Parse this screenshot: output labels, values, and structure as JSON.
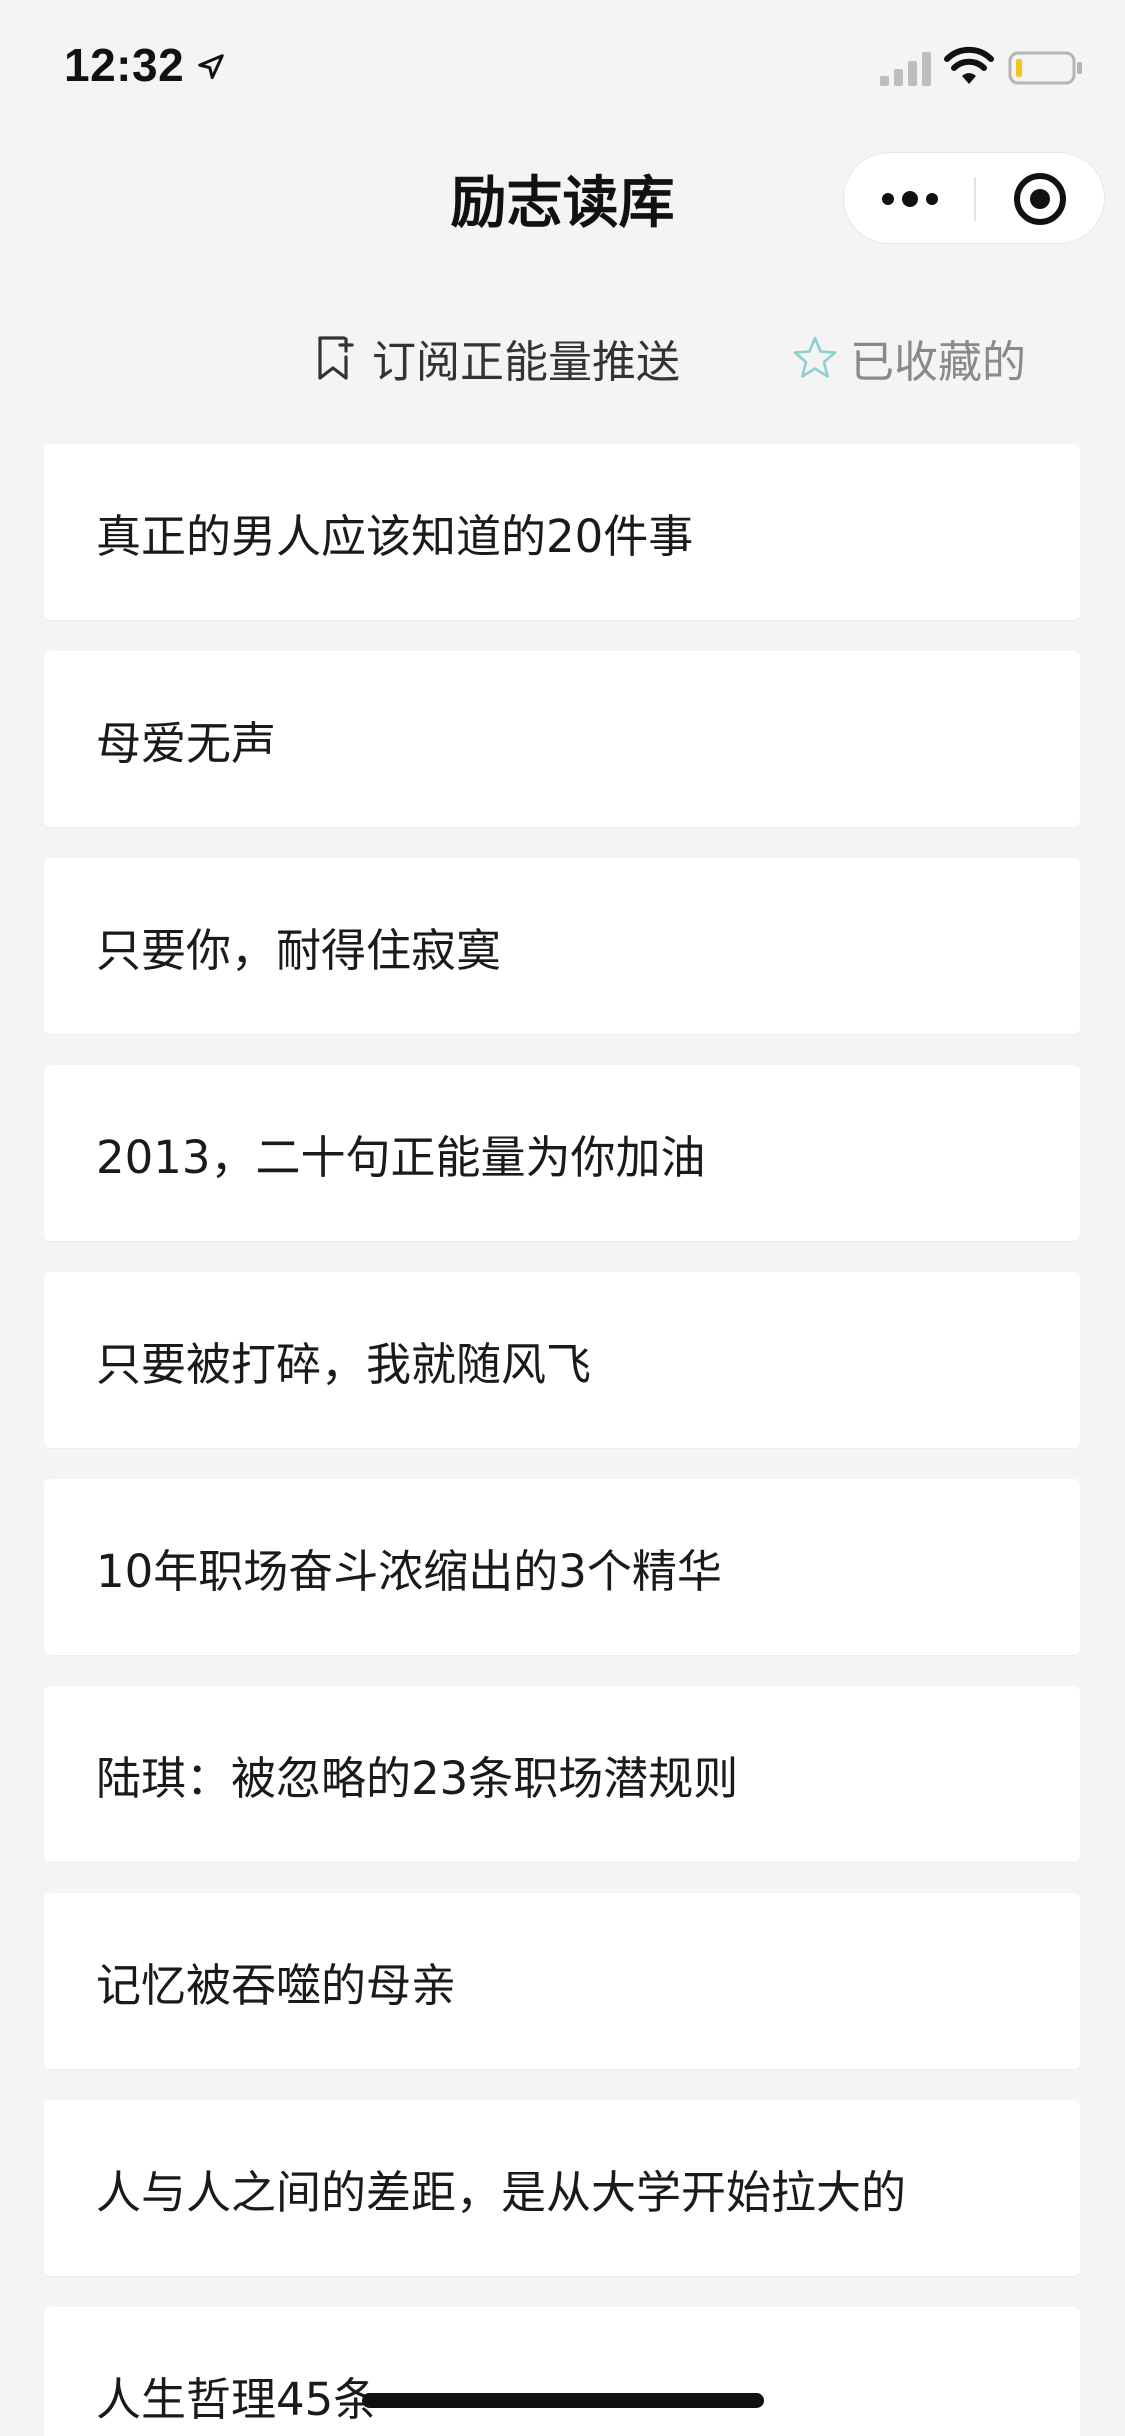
{
  "status_bar": {
    "time": "12:32",
    "icons": [
      "location-arrow-icon",
      "signal-icon",
      "wifi-icon",
      "battery-icon"
    ]
  },
  "nav": {
    "title": "励志读库",
    "capsule_icons": [
      "more-icon",
      "target-icon"
    ]
  },
  "actions": {
    "subscribe_label": "订阅正能量推送",
    "subscribe_icon": "bookmark-plus-icon",
    "favorites_label": "已收藏的",
    "favorites_icon": "star-icon",
    "favorites_icon_color": "#8ecfcf"
  },
  "articles": [
    {
      "title": "真正的男人应该知道的20件事"
    },
    {
      "title": "母爱无声"
    },
    {
      "title": "只要你，耐得住寂寞"
    },
    {
      "title": "2013，二十句正能量为你加油"
    },
    {
      "title": "只要被打碎，我就随风飞"
    },
    {
      "title": "10年职场奋斗浓缩出的3个精华"
    },
    {
      "title": "陆琪：被忽略的23条职场潜规则"
    },
    {
      "title": "记忆被吞噬的母亲"
    },
    {
      "title": "人与人之间的差距，是从大学开始拉大的"
    },
    {
      "title": "人生哲理45条"
    }
  ],
  "colors": {
    "background": "#f4f4f4",
    "card": "#ffffff",
    "battery_level": "#f5c518"
  }
}
